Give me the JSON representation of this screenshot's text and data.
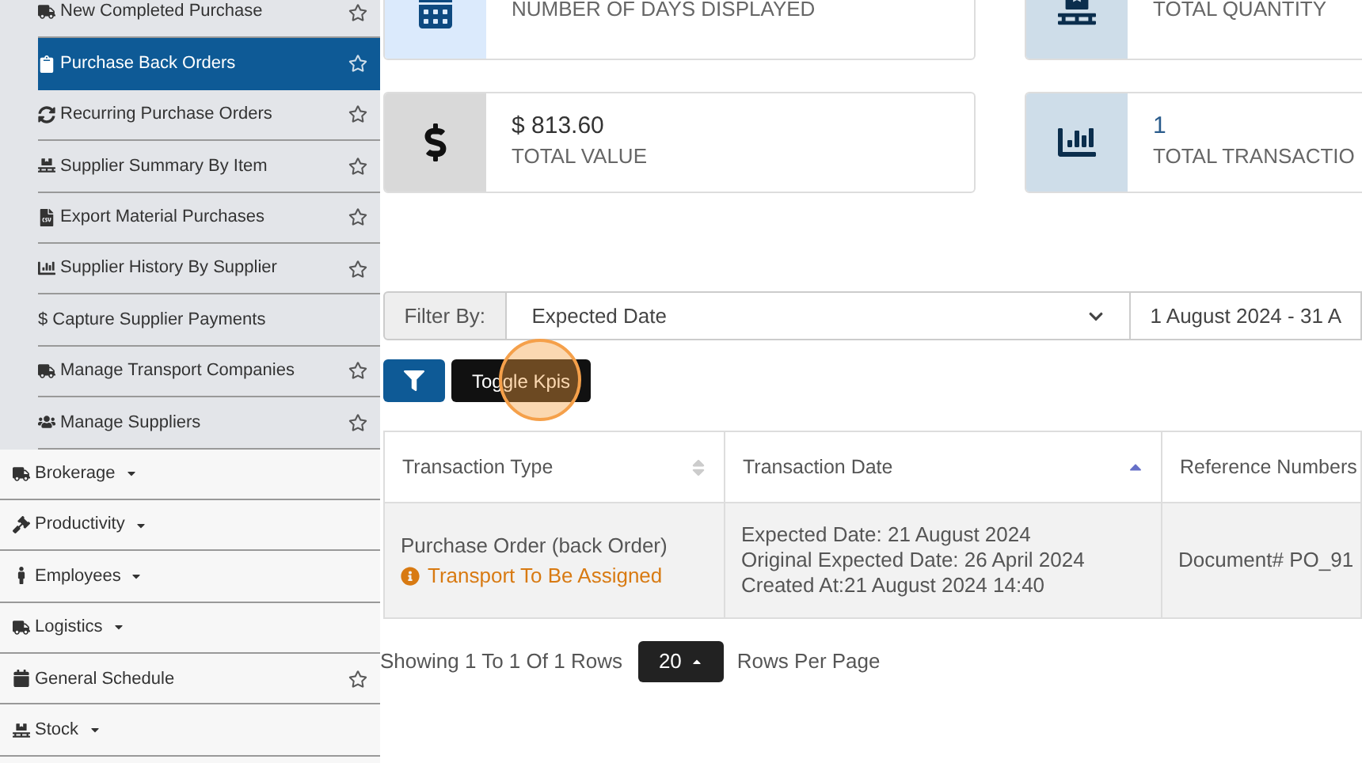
{
  "sidebar": {
    "items": [
      {
        "label": "New Completed Purchase",
        "kind": "sub",
        "starred": true,
        "selected": false
      },
      {
        "label": "Purchase Back Orders",
        "kind": "sub",
        "starred": true,
        "selected": true
      },
      {
        "label": "Recurring Purchase Orders",
        "kind": "sub",
        "starred": true,
        "selected": false
      },
      {
        "label": "Supplier Summary By Item",
        "kind": "sub",
        "starred": true,
        "selected": false
      },
      {
        "label": "Export Material Purchases",
        "kind": "sub",
        "starred": true,
        "selected": false
      },
      {
        "label": "Supplier History By Supplier",
        "kind": "sub",
        "starred": true,
        "selected": false
      },
      {
        "label": "$ Capture Supplier Payments",
        "kind": "sub",
        "starred": false,
        "selected": false
      },
      {
        "label": "Manage Transport Companies",
        "kind": "sub",
        "starred": true,
        "selected": false
      },
      {
        "label": "Manage Suppliers",
        "kind": "sub",
        "starred": true,
        "selected": false
      },
      {
        "label": "Brokerage",
        "kind": "menu",
        "starred": false,
        "selected": false
      },
      {
        "label": "Productivity",
        "kind": "menu",
        "starred": false,
        "selected": false
      },
      {
        "label": "Employees",
        "kind": "menu",
        "starred": false,
        "selected": false
      },
      {
        "label": "Logistics",
        "kind": "menu",
        "starred": false,
        "selected": false
      },
      {
        "label": "General Schedule",
        "kind": "link",
        "starred": true,
        "selected": false
      },
      {
        "label": "Stock",
        "kind": "menu",
        "starred": false,
        "selected": false
      }
    ]
  },
  "kpis": [
    {
      "label": "NUMBER OF DAYS DISPLAYED"
    },
    {
      "label": "TOTAL QUANTITY"
    },
    {
      "value": "$ 813.60",
      "label": "TOTAL VALUE"
    },
    {
      "value": "1",
      "label": "TOTAL TRANSACTIO"
    }
  ],
  "filter": {
    "label": "Filter By:",
    "value": "Expected Date",
    "date_range": "1 August 2024 - 31 A"
  },
  "toggle_button": "Toggle Kpis",
  "table": {
    "columns": [
      {
        "label": "Transaction Type",
        "sorted": false
      },
      {
        "label": "Transaction Date",
        "sorted": true
      },
      {
        "label": "Reference Numbers"
      }
    ],
    "rows": [
      {
        "type": "Purchase Order (back Order)",
        "status": "Transport To Be Assigned",
        "dates": [
          "Expected Date: 21 August 2024",
          "Original Expected Date: 26 April 2024",
          "Created At:21 August 2024 14:40"
        ],
        "reference": "Document# PO_91"
      }
    ]
  },
  "pagination": {
    "summary": "Showing 1 To 1 Of 1 Rows",
    "page_size": "20",
    "suffix": "Rows Per Page"
  }
}
